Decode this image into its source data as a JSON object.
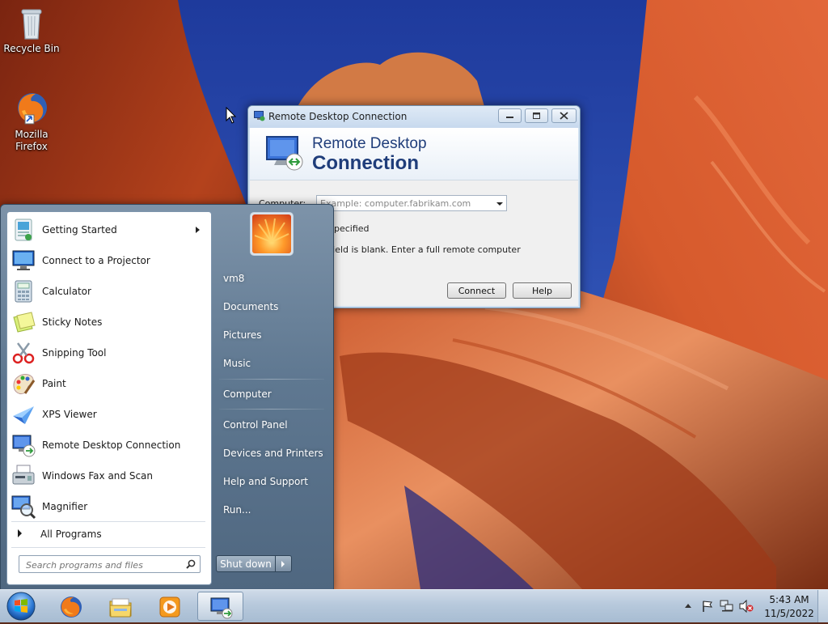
{
  "desktop": {
    "icons": [
      {
        "label": "Recycle Bin",
        "icon": "recycle-bin-icon"
      },
      {
        "label_line1": "Mozilla",
        "label_line2": "Firefox",
        "icon": "firefox-icon"
      }
    ]
  },
  "rdc_window": {
    "title": "Remote Desktop Connection",
    "banner_line1": "Remote Desktop",
    "banner_line2": "Connection",
    "computer_label": "Computer:",
    "computer_placeholder": "Example: computer.fabrikam.com",
    "message1": "e specified",
    "message2": "e field is blank. Enter a full remote computer",
    "connect_label": "Connect",
    "help_label": "Help"
  },
  "start_menu": {
    "programs": [
      {
        "label": "Getting Started",
        "icon": "getting-started-icon",
        "has_submenu": true
      },
      {
        "label": "Connect to a Projector",
        "icon": "projector-icon"
      },
      {
        "label": "Calculator",
        "icon": "calculator-icon"
      },
      {
        "label": "Sticky Notes",
        "icon": "sticky-notes-icon"
      },
      {
        "label": "Snipping Tool",
        "icon": "snipping-tool-icon"
      },
      {
        "label": "Paint",
        "icon": "paint-icon"
      },
      {
        "label": "XPS Viewer",
        "icon": "xps-viewer-icon"
      },
      {
        "label": "Remote Desktop Connection",
        "icon": "remote-desktop-icon"
      },
      {
        "label": "Windows Fax and Scan",
        "icon": "fax-scan-icon"
      },
      {
        "label": "Magnifier",
        "icon": "magnifier-icon"
      }
    ],
    "all_programs": "All Programs",
    "search_placeholder": "Search programs and files",
    "right_items": [
      {
        "label": "vm8"
      },
      {
        "label": "Documents"
      },
      {
        "label": "Pictures"
      },
      {
        "label": "Music"
      },
      {
        "label": "Computer"
      },
      {
        "label": "Control Panel"
      },
      {
        "label": "Devices and Printers"
      },
      {
        "label": "Help and Support"
      },
      {
        "label": "Run..."
      }
    ],
    "shutdown_label": "Shut down"
  },
  "taskbar": {
    "clock_time": "5:43 AM",
    "clock_date": "11/5/2022",
    "pinned": [
      "firefox-icon",
      "explorer-icon",
      "media-player-icon",
      "remote-desktop-icon"
    ]
  },
  "colors": {
    "start_panel": "#5f7891",
    "rdc_banner_text": "#1f3d7a",
    "taskbar": "#b7c9dc"
  }
}
